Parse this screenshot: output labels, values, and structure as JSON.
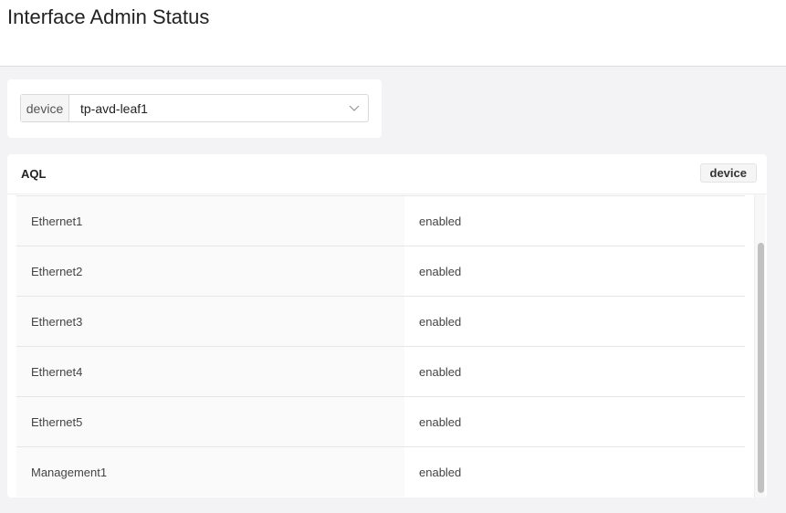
{
  "header": {
    "title": "Interface Admin Status"
  },
  "filter": {
    "label": "device",
    "value": "tp-avd-leaf1"
  },
  "panel": {
    "title": "AQL",
    "badge": "device",
    "rows": [
      {
        "interface": "Ethernet1",
        "status": "enabled"
      },
      {
        "interface": "Ethernet2",
        "status": "enabled"
      },
      {
        "interface": "Ethernet3",
        "status": "enabled"
      },
      {
        "interface": "Ethernet4",
        "status": "enabled"
      },
      {
        "interface": "Ethernet5",
        "status": "enabled"
      },
      {
        "interface": "Management1",
        "status": "enabled"
      }
    ]
  }
}
